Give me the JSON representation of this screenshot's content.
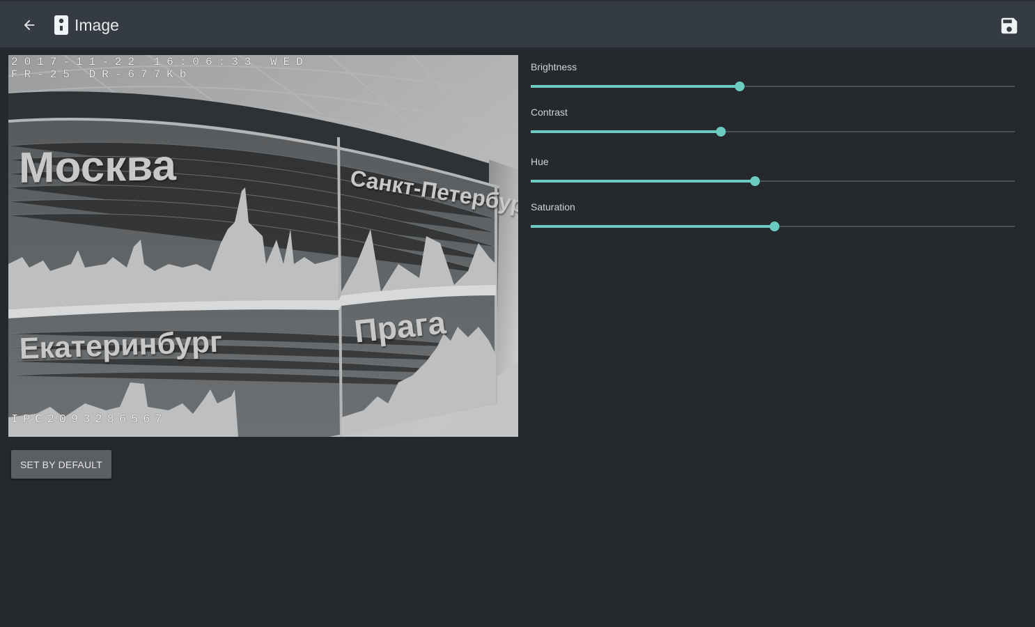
{
  "header": {
    "title": "Image",
    "back_icon": "arrow-left-icon",
    "camera_icon": "camera-device-icon",
    "save_icon": "floppy-disk-icon"
  },
  "preview": {
    "timestamp": "2017-11-22 16:06:33 WED",
    "stream_info": "FR-25 DR-677Kb",
    "camera_id": "IPC2093286567",
    "signs": [
      "Москва",
      "Санкт-Петербург",
      "Екатеринбург",
      "Прага"
    ]
  },
  "controls": {
    "default_button": "SET BY DEFAULT",
    "sliders": [
      {
        "label": "Brightness",
        "value": 0.432
      },
      {
        "label": "Contrast",
        "value": 0.393
      },
      {
        "label": "Hue",
        "value": 0.463
      },
      {
        "label": "Saturation",
        "value": 0.503
      }
    ]
  },
  "colors": {
    "accent": "#6ccbc0",
    "appbar": "#353b43",
    "background": "#25292d"
  }
}
